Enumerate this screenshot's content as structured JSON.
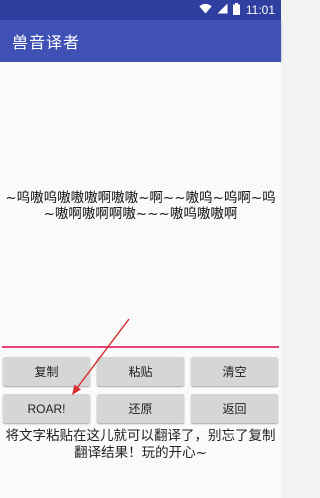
{
  "status_bar": {
    "time": "11:01",
    "icons": [
      "wifi-icon",
      "signal-icon",
      "battery-icon"
    ]
  },
  "app_bar": {
    "title": "兽音译者",
    "color": "#3f51b5"
  },
  "main": {
    "translated_text": "~呜嗷呜嗷嗷嗷啊嗷嗷~啊~~嗷呜~呜啊~呜~嗷啊嗷啊啊嗷~~~嗷呜嗷嗷啊"
  },
  "buttons": {
    "copy": "复制",
    "paste": "粘贴",
    "clear": "清空",
    "roar": "ROAR!",
    "restore": "还原",
    "back": "返回"
  },
  "hint": "将文字粘贴在这儿就可以翻译了，别忘了复制翻译结果！玩的开心~",
  "colors": {
    "input_underline": "#e6437a",
    "annotation_arrow": "#d32f2f"
  }
}
